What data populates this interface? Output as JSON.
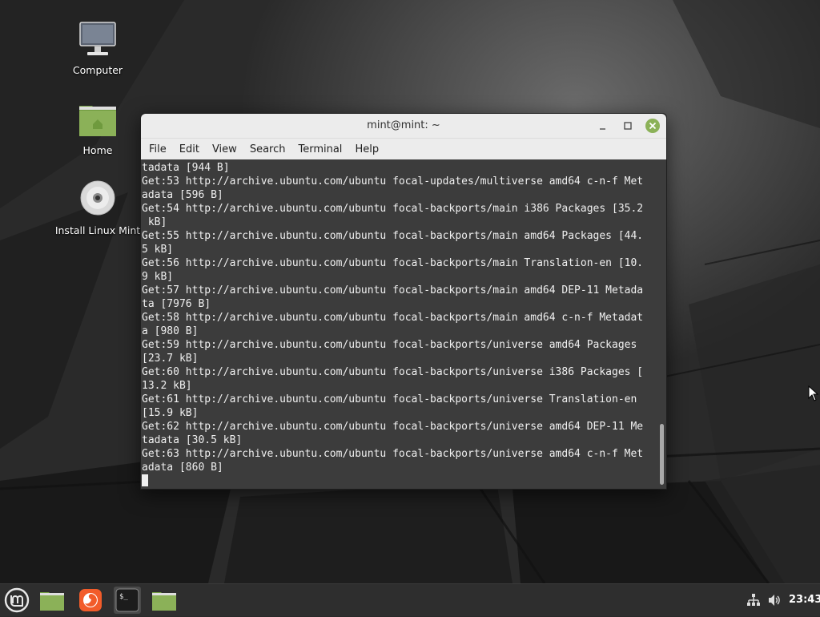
{
  "desktop": {
    "icons": [
      {
        "label": "Computer"
      },
      {
        "label": "Home"
      },
      {
        "label": "Install Linux Mint"
      }
    ]
  },
  "window": {
    "title": "mint@mint: ~",
    "menu": [
      "File",
      "Edit",
      "View",
      "Search",
      "Terminal",
      "Help"
    ]
  },
  "terminal": {
    "lines": [
      "tadata [944 B]",
      "Get:53 http://archive.ubuntu.com/ubuntu focal-updates/multiverse amd64 c-n-f Met",
      "adata [596 B]",
      "Get:54 http://archive.ubuntu.com/ubuntu focal-backports/main i386 Packages [35.2",
      " kB]",
      "Get:55 http://archive.ubuntu.com/ubuntu focal-backports/main amd64 Packages [44.",
      "5 kB]",
      "Get:56 http://archive.ubuntu.com/ubuntu focal-backports/main Translation-en [10.",
      "9 kB]",
      "Get:57 http://archive.ubuntu.com/ubuntu focal-backports/main amd64 DEP-11 Metada",
      "ta [7976 B]",
      "Get:58 http://archive.ubuntu.com/ubuntu focal-backports/main amd64 c-n-f Metadat",
      "a [980 B]",
      "Get:59 http://archive.ubuntu.com/ubuntu focal-backports/universe amd64 Packages",
      "[23.7 kB]",
      "Get:60 http://archive.ubuntu.com/ubuntu focal-backports/universe i386 Packages [",
      "13.2 kB]",
      "Get:61 http://archive.ubuntu.com/ubuntu focal-backports/universe Translation-en",
      "[15.9 kB]",
      "Get:62 http://archive.ubuntu.com/ubuntu focal-backports/universe amd64 DEP-11 Me",
      "tadata [30.5 kB]",
      "Get:63 http://archive.ubuntu.com/ubuntu focal-backports/universe amd64 c-n-f Met",
      "adata [860 B]"
    ]
  },
  "taskbar": {
    "clock": "23:43"
  },
  "icons": {
    "menu": "mint-logo-icon",
    "files": "folder-icon",
    "browser": "firefox-icon",
    "terminal": "terminal-icon",
    "network": "network-icon",
    "volume": "volume-icon"
  },
  "colors": {
    "mint_green": "#8bb158",
    "close_button": "#8bb158",
    "terminal_bg": "#3c3c3c"
  }
}
